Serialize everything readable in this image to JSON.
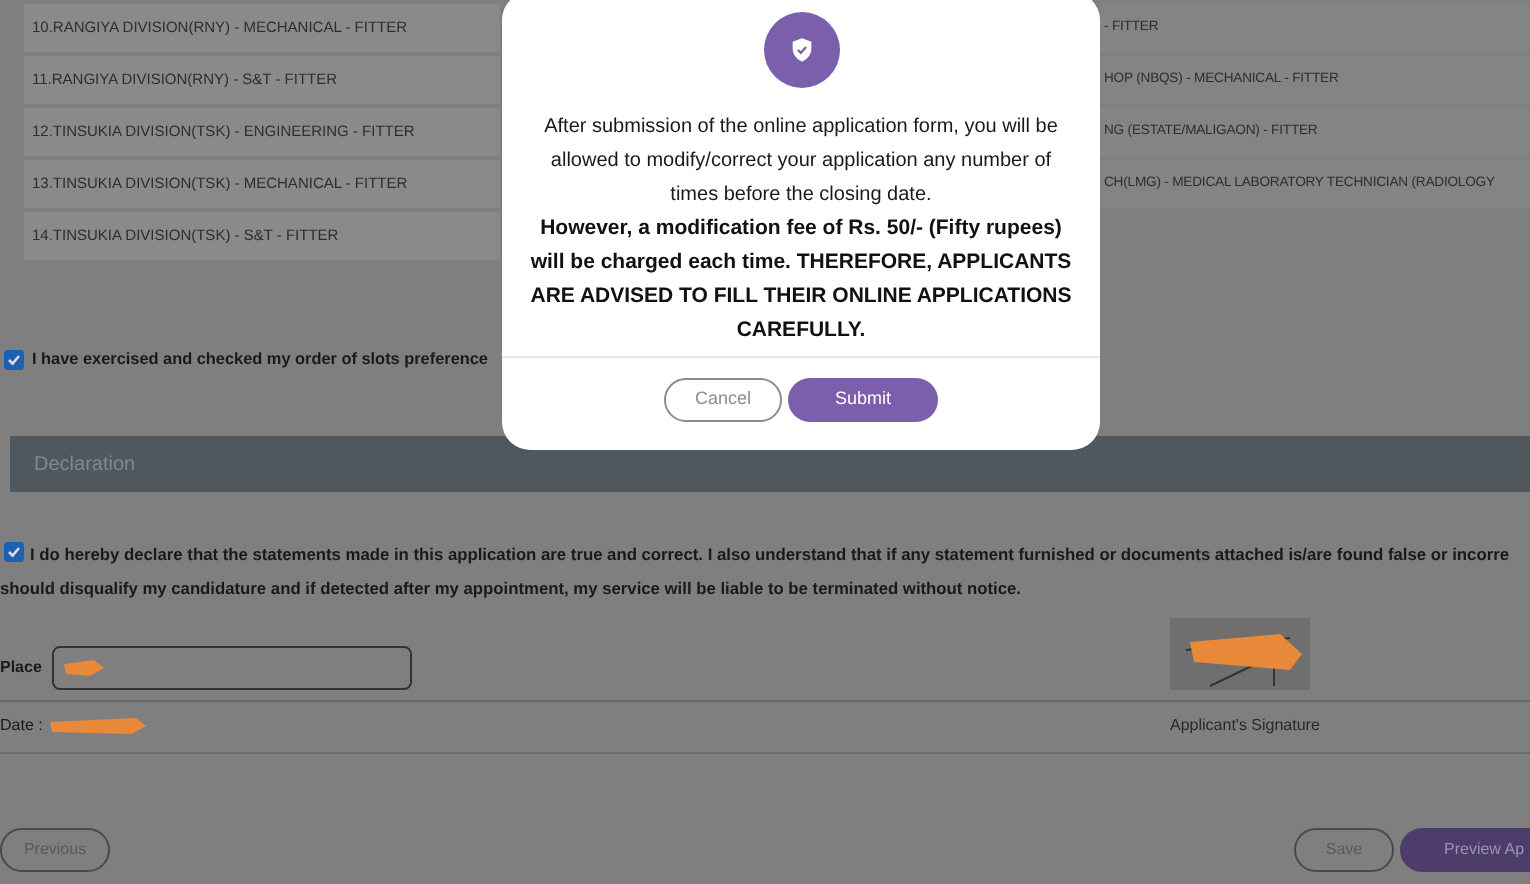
{
  "slots_left": [
    "10.RANGIYA DIVISION(RNY) - MECHANICAL - FITTER",
    "11.RANGIYA DIVISION(RNY) - S&T - FITTER",
    "12.TINSUKIA DIVISION(TSK) - ENGINEERING - FITTER",
    "13.TINSUKIA DIVISION(TSK) - MECHANICAL - FITTER",
    "14.TINSUKIA DIVISION(TSK) - S&T - FITTER"
  ],
  "slots_right": [
    "- FITTER",
    "HOP (NBQS) - MECHANICAL - FITTER",
    "NG (ESTATE/MALIGAON) - FITTER",
    "CH(LMG) - MEDICAL LABORATORY TECHNICIAN (RADIOLOGY"
  ],
  "slots_confirm": {
    "label": "I have exercised and checked my order of slots preference",
    "checked": true
  },
  "declaration": {
    "title": "Declaration",
    "checked": true,
    "lines": [
      "I do hereby declare that the statements made in this application are true and correct. I also understand that if any statement furnished or documents attached is/are found false or incorre",
      "should disqualify my candidature and if detected after my appointment, my service will be liable to be terminated without notice."
    ],
    "place_label": "Place",
    "date_label": "Date :",
    "signature_label": "Applicant's Signature"
  },
  "footer_buttons": {
    "previous": "Previous",
    "save": "Save",
    "preview": "Preview Ap"
  },
  "modal": {
    "message": "After submission of the online application form, you will be allowed to modify/correct your application any number of times before the closing date.",
    "warning": "However, a modification fee of Rs. 50/- (Fifty rupees) will be charged each time. THEREFORE, APPLICANTS ARE ADVISED TO FILL THEIR ONLINE APPLICATIONS CAREFULLY.",
    "cancel": "Cancel",
    "submit": "Submit"
  }
}
